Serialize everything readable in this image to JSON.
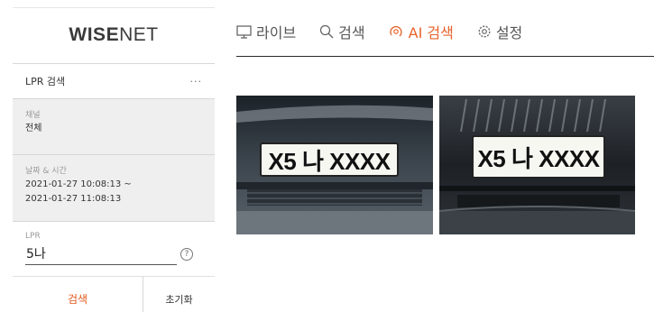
{
  "app": {
    "logo_text_bold": "WISE",
    "logo_text_light": "NET"
  },
  "nav": {
    "items": [
      {
        "label": "라이브",
        "icon": "monitor-icon",
        "active": false
      },
      {
        "label": "검색",
        "icon": "search-icon",
        "active": false
      },
      {
        "label": "AI 검색",
        "icon": "ai-search-icon",
        "active": true
      },
      {
        "label": "설정",
        "icon": "gear-icon",
        "active": false
      }
    ],
    "accent_color": "#e8632a"
  },
  "panel": {
    "title": "LPR 검색",
    "more": "···",
    "channel_label": "채널",
    "channel_value": "전체",
    "datetime_label": "날짜 & 시간",
    "datetime_start": "2021-01-27 10:08:13 ~",
    "datetime_end": "2021-01-27 11:08:13",
    "lpr_label": "LPR",
    "lpr_value": "5나",
    "help_icon_text": "?",
    "search_button": "검색",
    "reset_button": "초기화"
  },
  "results": [
    {
      "plate": "X5 나 XXXX"
    },
    {
      "plate": "X5 나 XXXX"
    }
  ]
}
